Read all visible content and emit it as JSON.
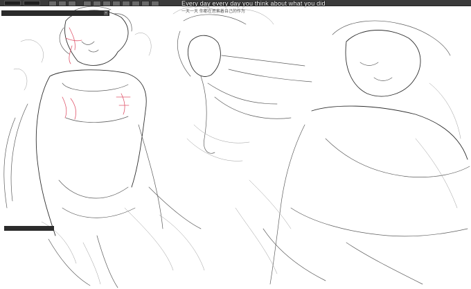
{
  "toolbar": {
    "label_1": "",
    "label_2": ""
  },
  "panel": {
    "title": "",
    "close_label": "×"
  },
  "bottom_panel": {
    "label": ""
  },
  "subtitles": {
    "english": "Every day every day you think about what you did",
    "chinese": "一天一天 你都在思索着自己的作为"
  },
  "colors": {
    "line_art": "#5a5a5a",
    "red_sketch": "#e0556b",
    "toolbar_bg": "#3b3b3b"
  }
}
